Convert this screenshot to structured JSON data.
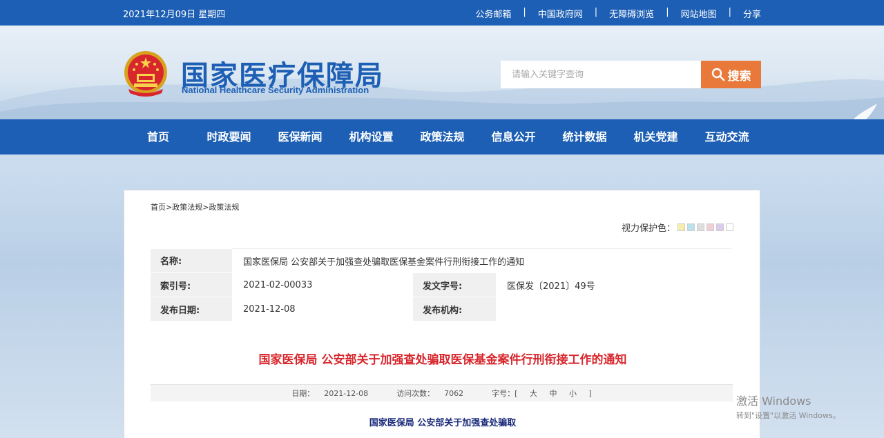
{
  "topbar": {
    "date": "2021年12月09日 星期四",
    "links": [
      "公务邮箱",
      "中国政府网",
      "无障碍浏览",
      "网站地图",
      "分享"
    ],
    "separator": "|"
  },
  "header": {
    "logo_cn": "国家医疗保障局",
    "logo_en": "National Healthcare Security Administration",
    "emblem_icon": "national-emblem-icon",
    "search_placeholder": "请输入关键字查询",
    "search_label": "搜索"
  },
  "nav": {
    "items": [
      "首页",
      "时政要闻",
      "医保新闻",
      "机构设置",
      "政策法规",
      "信息公开",
      "统计数据",
      "机关党建",
      "互动交流"
    ]
  },
  "breadcrumb": [
    "首页",
    "政策法规",
    "政策法规"
  ],
  "breadcrumb_sep": ">",
  "vision": {
    "label": "视力保护色：",
    "swatches": [
      "#f7eeae",
      "#b9e2ee",
      "#dedede",
      "#f2cfd6",
      "#dccdef",
      "#ffffff"
    ]
  },
  "meta": {
    "name_label": "名称:",
    "name_value": "国家医保局 公安部关于加强查处骗取医保基金案件行刑衔接工作的通知",
    "index_label": "索引号:",
    "index_value": "2021-02-00033",
    "doc_label": "发文字号:",
    "doc_value": "医保发〔2021〕49号",
    "date_label": "发布日期:",
    "date_value": "2021-12-08",
    "org_label": "发布机构:",
    "org_value": ""
  },
  "article": {
    "title": "国家医保局 公安部关于加强查处骗取医保基金案件行刑衔接工作的通知",
    "date_label": "日期：",
    "date": "2021-12-08",
    "visits_label": "访问次数：",
    "visits": "7062",
    "size_label": "字号：[",
    "size_large": "大",
    "size_mid": "中",
    "size_small": "小",
    "size_end": "]",
    "sub_title": "国家医保局  公安部关于加强查处骗取"
  },
  "watermark": {
    "line1": "激活 Windows",
    "line2": "转到\"设置\"以激活 Windows。"
  },
  "colors": {
    "brand_blue": "#1d5fb4",
    "search_orange": "#e9793a",
    "title_red": "#d7262c"
  }
}
